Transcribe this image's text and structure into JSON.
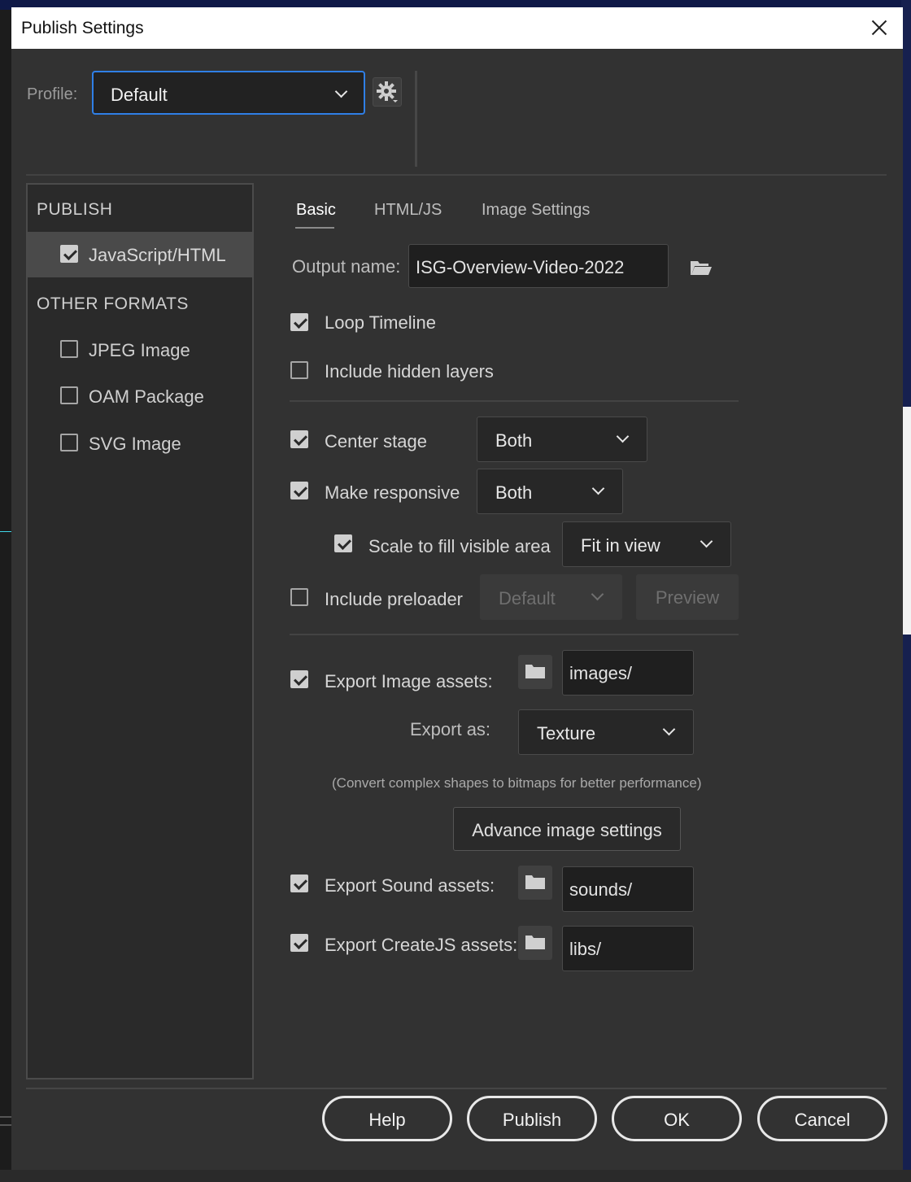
{
  "window": {
    "title": "Publish Settings"
  },
  "profile": {
    "label": "Profile:",
    "value": "Default"
  },
  "sidebar": {
    "publish_header": "PUBLISH",
    "publish_items": [
      {
        "label": "JavaScript/HTML",
        "checked": true
      }
    ],
    "other_header": "OTHER FORMATS",
    "other_items": [
      {
        "label": "JPEG Image",
        "checked": false
      },
      {
        "label": "OAM Package",
        "checked": false
      },
      {
        "label": "SVG Image",
        "checked": false
      }
    ]
  },
  "tabs": [
    {
      "label": "Basic",
      "active": true
    },
    {
      "label": "HTML/JS",
      "active": false
    },
    {
      "label": "Image Settings",
      "active": false
    }
  ],
  "basic": {
    "output_name_label": "Output name:",
    "output_name": "ISG-Overview-Video-2022",
    "loop_timeline": {
      "label": "Loop Timeline",
      "checked": true
    },
    "include_hidden_layers": {
      "label": "Include hidden layers",
      "checked": false
    },
    "center_stage": {
      "label": "Center stage",
      "checked": true,
      "value": "Both"
    },
    "make_responsive": {
      "label": "Make responsive",
      "checked": true,
      "value": "Both"
    },
    "scale_to_fill": {
      "label": "Scale to fill visible area",
      "checked": true,
      "value": "Fit in view"
    },
    "include_preloader": {
      "label": "Include preloader",
      "checked": false,
      "value": "Default",
      "preview_label": "Preview"
    },
    "export_image_assets": {
      "label": "Export Image assets:",
      "checked": true,
      "folder": "images/"
    },
    "export_as": {
      "label": "Export as:",
      "value": "Texture"
    },
    "export_note": "(Convert complex shapes to bitmaps for better performance)",
    "advance_image_settings_label": "Advance image settings",
    "export_sound_assets": {
      "label": "Export Sound assets:",
      "checked": true,
      "folder": "sounds/"
    },
    "export_createjs_assets": {
      "label": "Export CreateJS assets:",
      "checked": true,
      "folder": "libs/"
    }
  },
  "footer": {
    "help": "Help",
    "publish": "Publish",
    "ok": "OK",
    "cancel": "Cancel"
  },
  "colors": {
    "focus_accent": "#2f7fe6",
    "dialog_bg": "#323232",
    "titlebar_bg": "#ffffff"
  }
}
